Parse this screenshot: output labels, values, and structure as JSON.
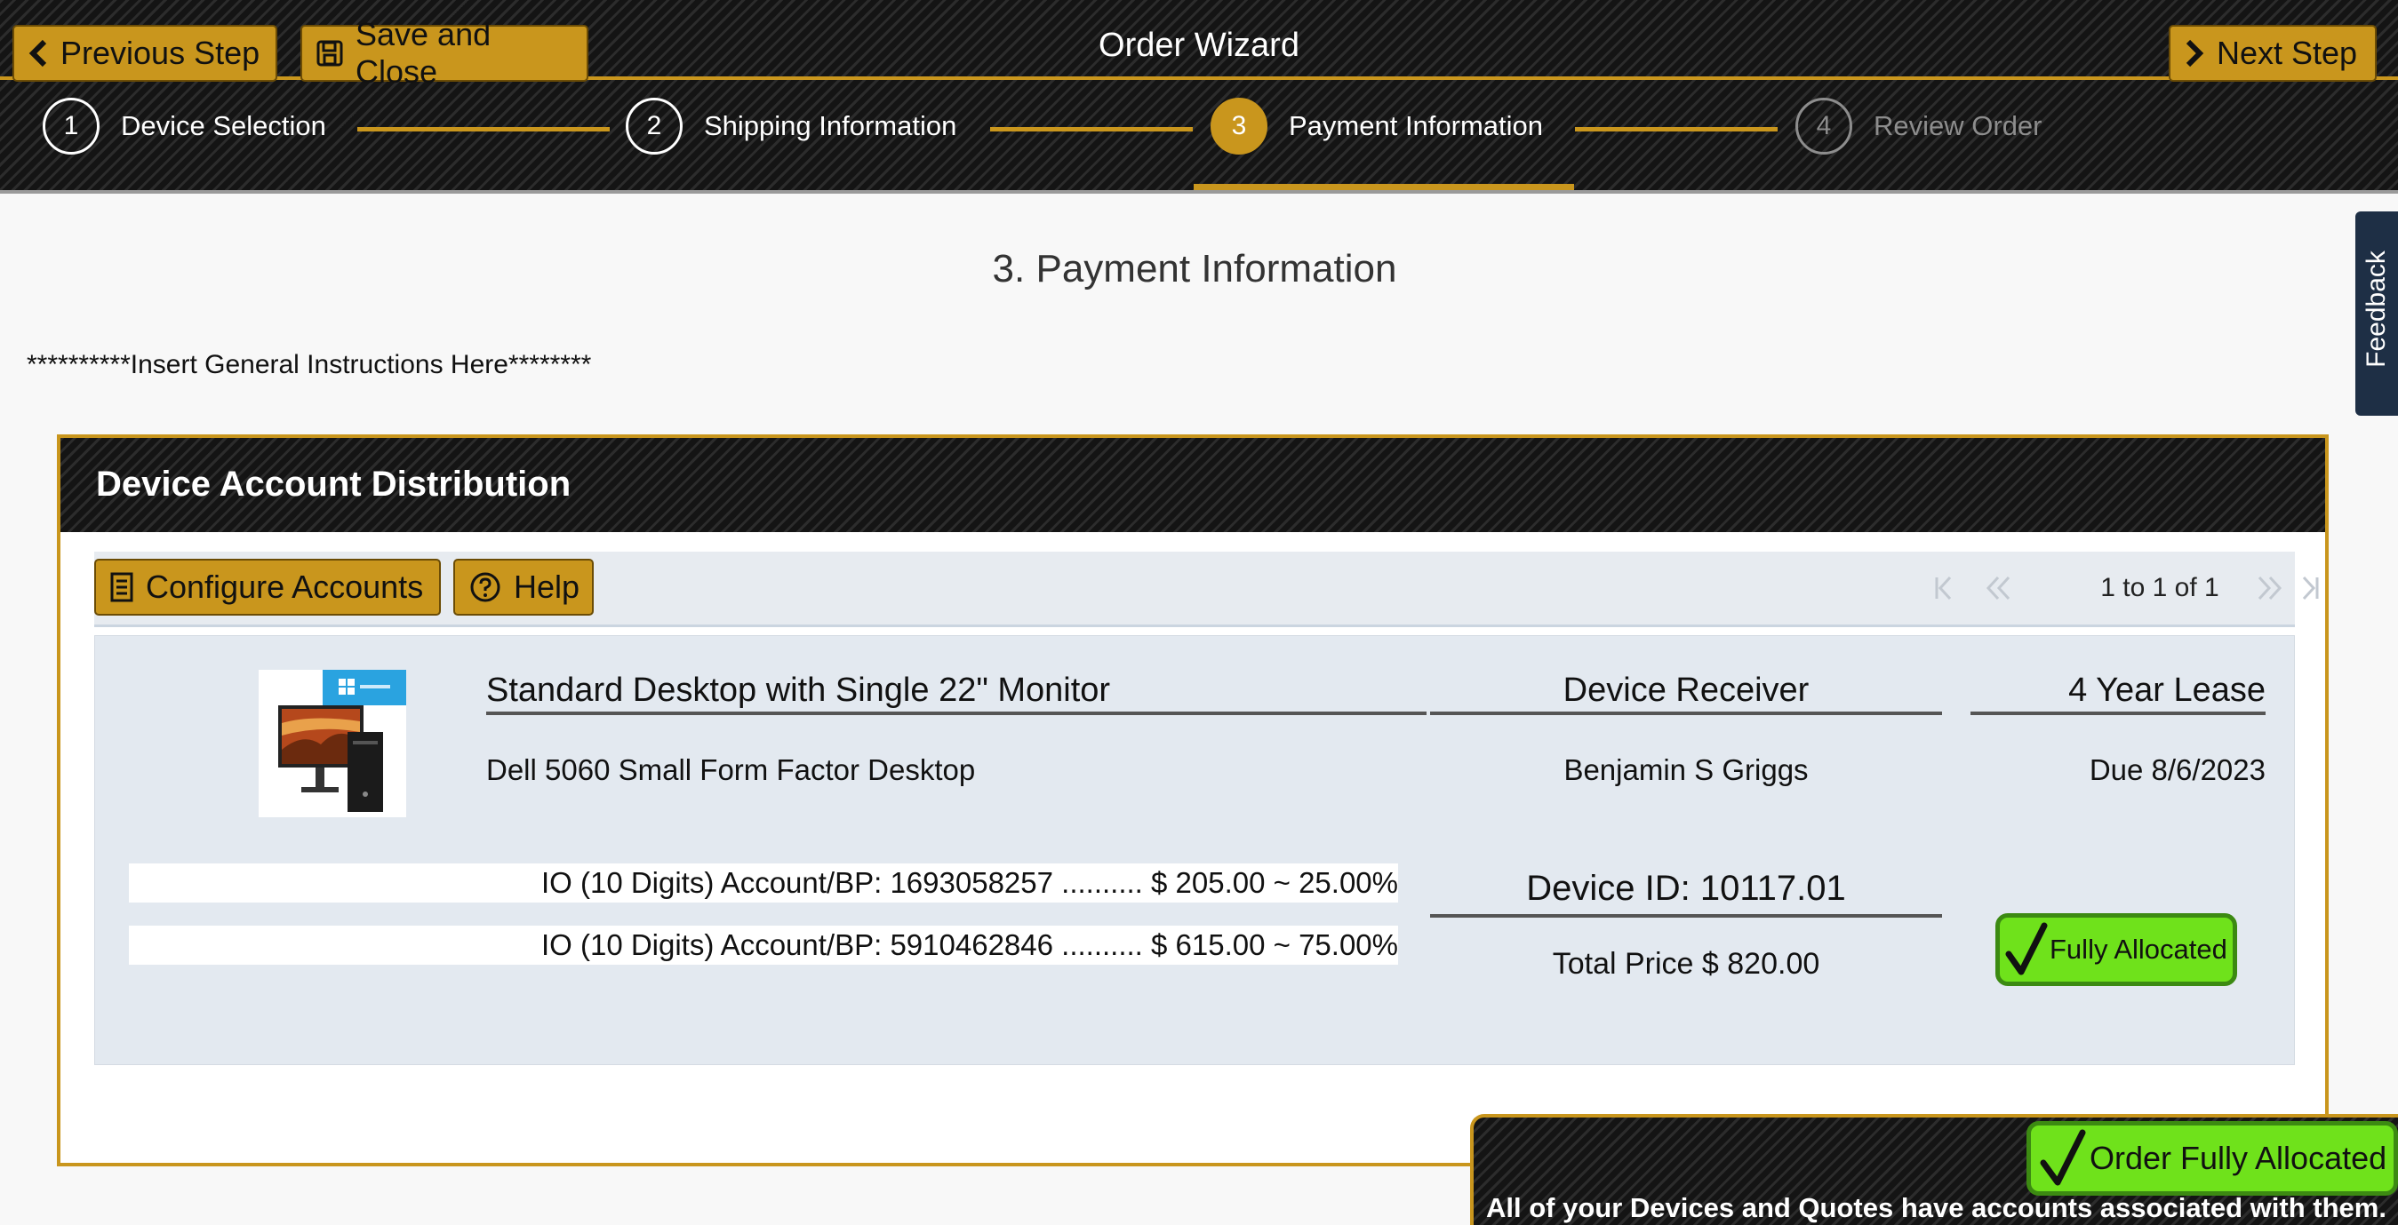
{
  "header": {
    "title": "Order Wizard",
    "prev_label": "Previous Step",
    "save_label": "Save and Close",
    "next_label": "Next Step"
  },
  "steps": [
    {
      "num": "1",
      "label": "Device Selection",
      "state": "complete"
    },
    {
      "num": "2",
      "label": "Shipping Information",
      "state": "complete"
    },
    {
      "num": "3",
      "label": "Payment Information",
      "state": "active"
    },
    {
      "num": "4",
      "label": "Review Order",
      "state": "disabled"
    }
  ],
  "feedback": {
    "label": "Feedback"
  },
  "page": {
    "title": "3. Payment Information",
    "instructions": "**********Insert General Instructions Here********"
  },
  "panel": {
    "title": "Device Account Distribution",
    "configure_label": "Configure Accounts",
    "help_label": "Help",
    "pager_text": "1 to 1 of 1"
  },
  "device": {
    "title": "Standard Desktop with Single 22\" Monitor",
    "model": "Dell 5060 Small Form Factor Desktop",
    "receiver_heading": "Device Receiver",
    "receiver_name": "Benjamin S Griggs",
    "lease": "4 Year Lease",
    "due": "Due 8/6/2023",
    "device_id": "Device ID: 10117.01",
    "total_price": "Total Price $ 820.00",
    "allocation_status": "Fully Allocated",
    "accounts": [
      {
        "text": "IO (10 Digits) Account/BP: 1693058257 .......... $ 205.00 ~ 25.00%"
      },
      {
        "text": "IO (10 Digits) Account/BP: 5910462846 .......... $ 615.00 ~ 75.00%"
      }
    ]
  },
  "order_status": {
    "badge": "Order Fully Allocated",
    "message": "All of your Devices and Quotes have accounts associated with them."
  },
  "colors": {
    "gold": "#c9961d",
    "success_green": "#6fe21b",
    "header_dark": "#141414",
    "feedback_navy": "#1e2f45"
  }
}
